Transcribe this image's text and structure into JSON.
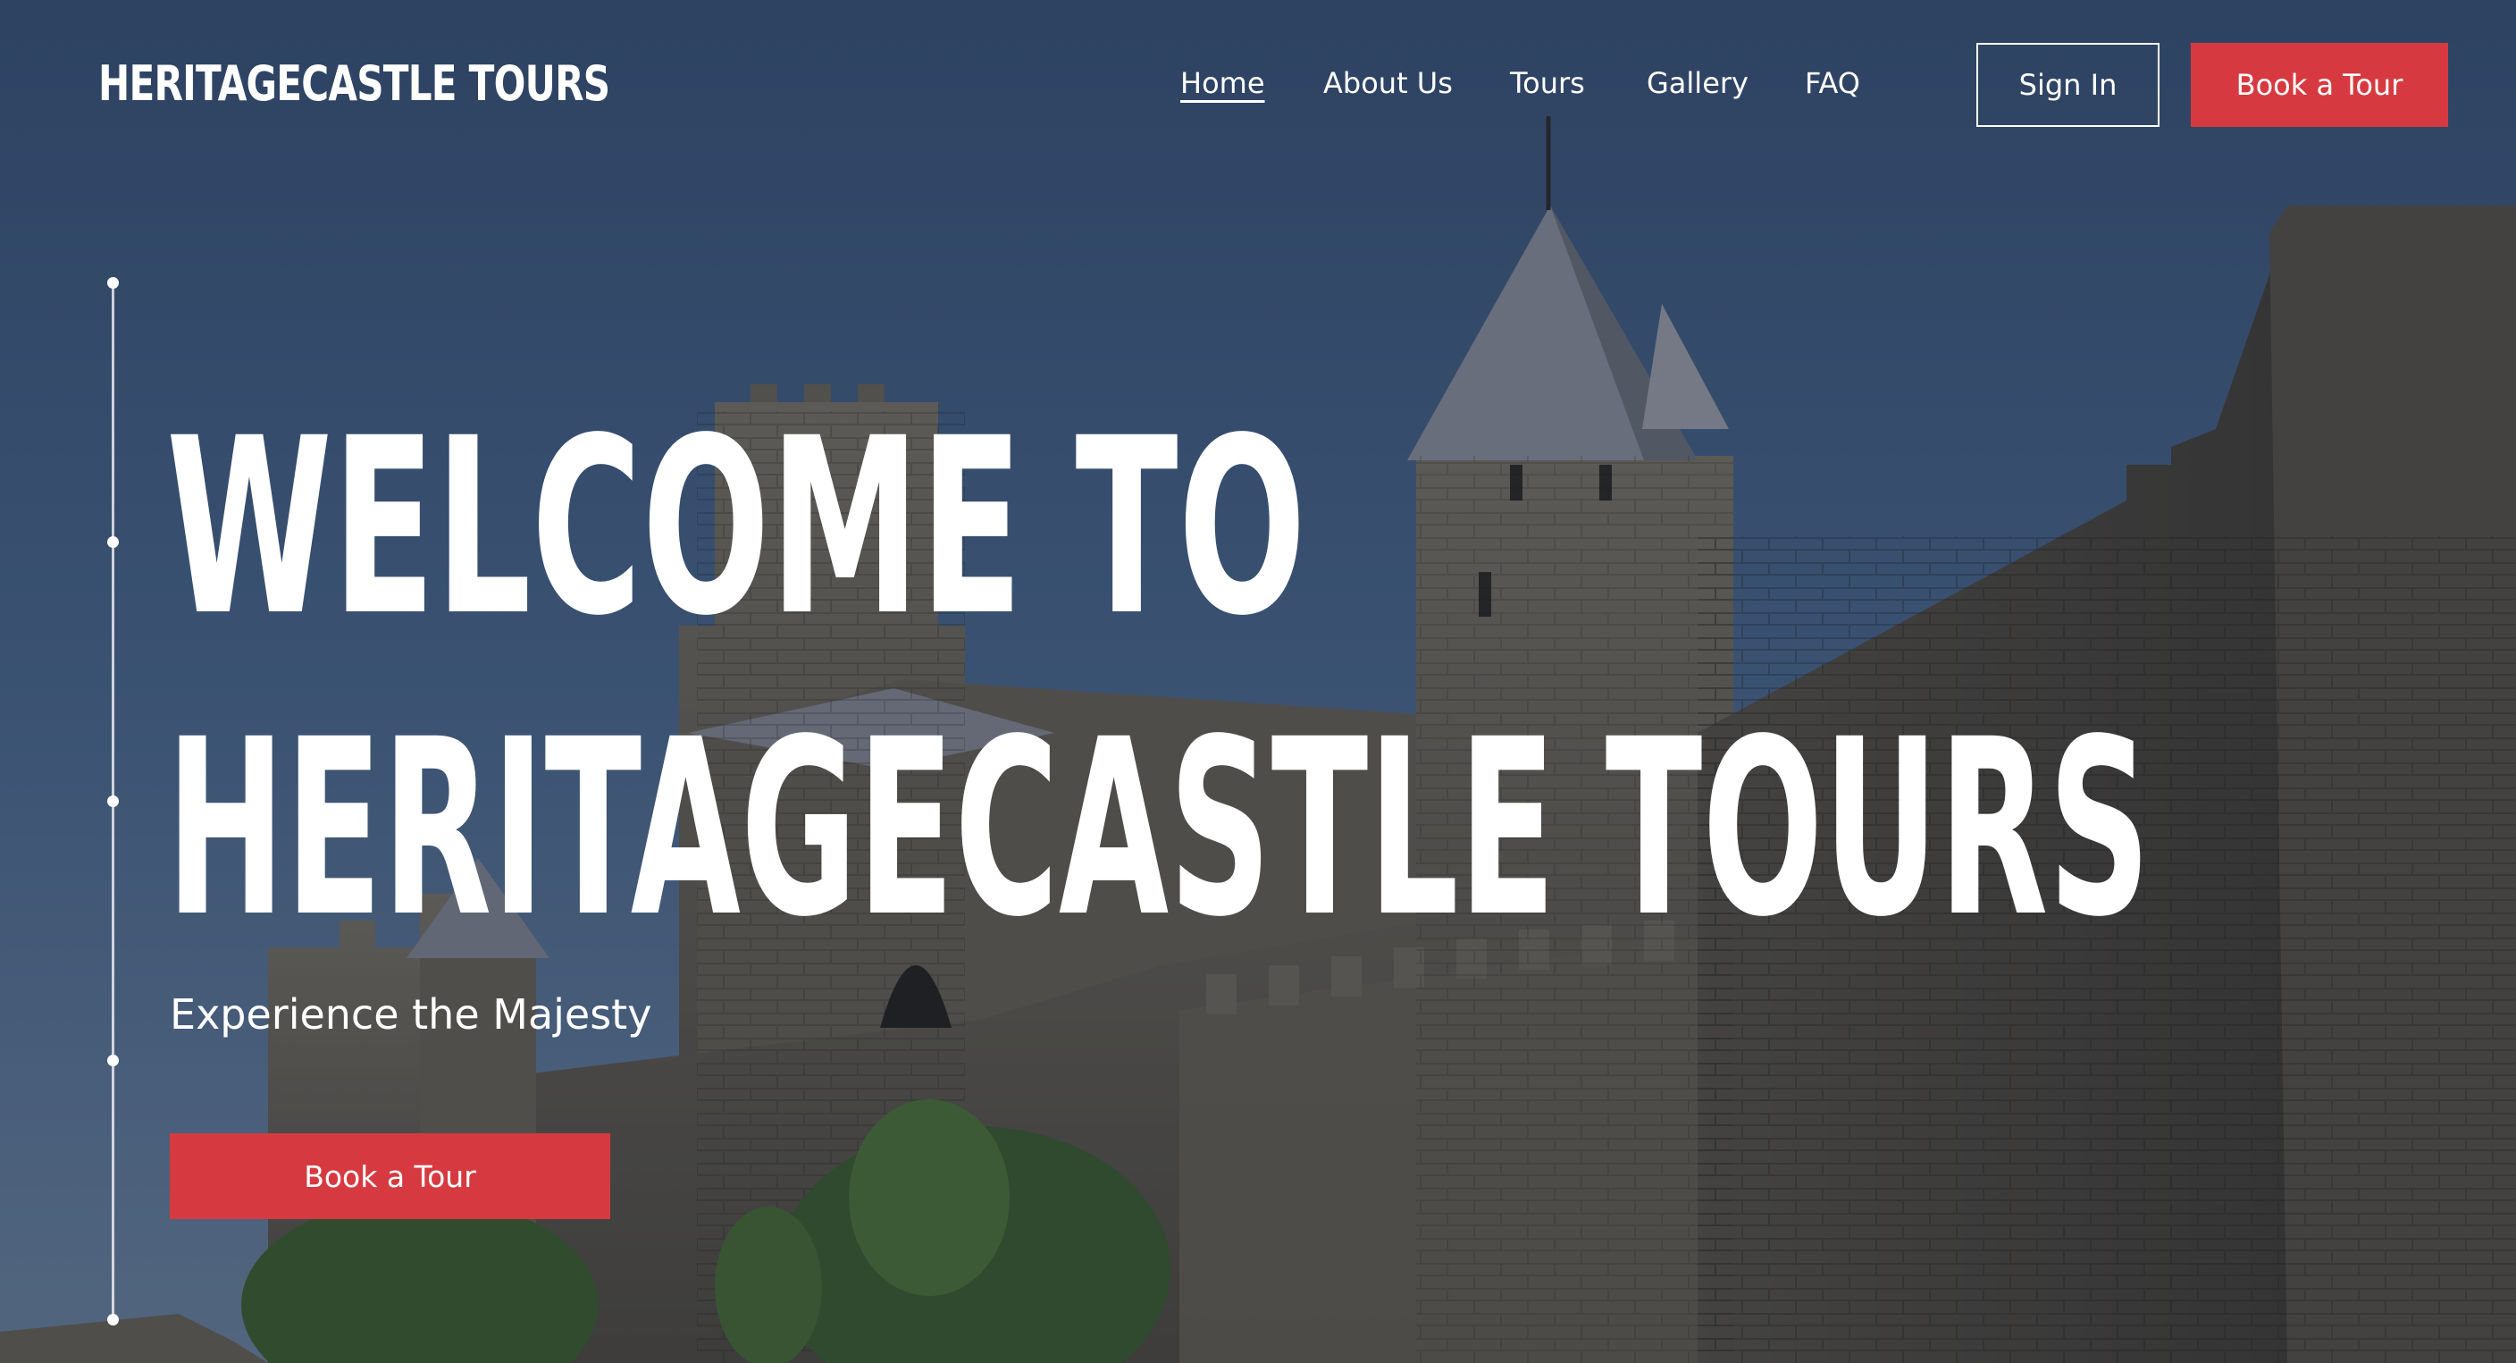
{
  "brand": {
    "logo_text": "HERITAGECASTLE TOURS"
  },
  "nav": {
    "items": [
      {
        "label": "Home",
        "active": true
      },
      {
        "label": "About Us",
        "active": false
      },
      {
        "label": "Tours",
        "active": false
      },
      {
        "label": "Gallery",
        "active": false
      },
      {
        "label": "FAQ",
        "active": false
      }
    ],
    "sign_in_label": "Sign In",
    "book_label": "Book a Tour"
  },
  "hero": {
    "headline_line1": "WELCOME TO",
    "headline_line2": "HERITAGECASTLE TOURS",
    "subtitle": "Experience the Majesty",
    "cta_label": "Book a Tour",
    "slides_count": 5,
    "active_slide": 1,
    "background": "castle-walls-photo"
  },
  "colors": {
    "accent": "#d63a40",
    "text": "#ffffff"
  }
}
